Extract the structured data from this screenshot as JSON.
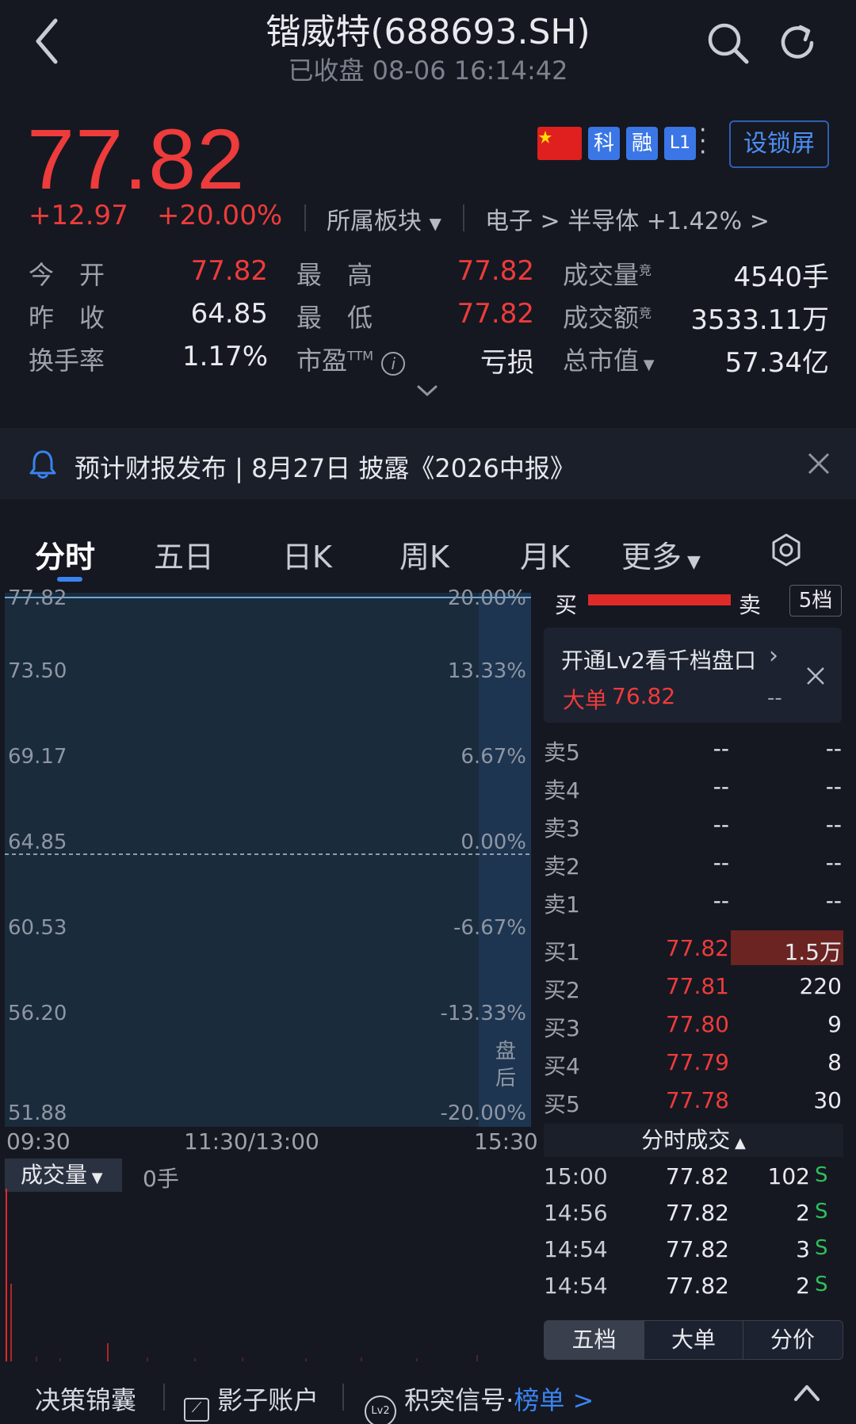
{
  "header": {
    "title": "锴威特(688693.SH)",
    "subtitle": "已收盘 08-06 16:14:42"
  },
  "quote": {
    "price": "77.82",
    "change": "+12.97",
    "change_pct": "+20.00%",
    "sector_label": "所属板块",
    "industry": "电子 > 半导体 +1.42% >",
    "tags": [
      "科",
      "融",
      "L1"
    ],
    "lock_screen": "设锁屏"
  },
  "stats": [
    {
      "label": "今　开",
      "value": "77.82",
      "color": "red"
    },
    {
      "label": "最　高",
      "value": "77.82",
      "color": "red"
    },
    {
      "label": "成交量",
      "sup": "竞",
      "value": "4540手",
      "color": "white"
    },
    {
      "label": "昨　收",
      "value": "64.85",
      "color": "white"
    },
    {
      "label": "最　低",
      "value": "77.82",
      "color": "red"
    },
    {
      "label": "成交额",
      "sup": "竞",
      "value": "3533.11万",
      "color": "white"
    },
    {
      "label": "换手率",
      "value": "1.17%",
      "color": "white"
    },
    {
      "label": "市盈",
      "sup": "TTM",
      "value": "亏损",
      "color": "white"
    },
    {
      "label": "总市值",
      "value": "57.34亿",
      "color": "white"
    }
  ],
  "notice": {
    "text": "预计财报发布 | 8月27日 披露《2026中报》"
  },
  "tabs": [
    "分时",
    "五日",
    "日K",
    "周K",
    "月K",
    "更多"
  ],
  "chart": {
    "price_ticks": [
      "77.82",
      "73.50",
      "69.17",
      "64.85",
      "60.53",
      "56.20",
      "51.88"
    ],
    "pct_ticks": [
      "20.00%",
      "13.33%",
      "6.67%",
      "0.00%",
      "-6.67%",
      "-13.33%",
      "-20.00%"
    ],
    "after_hours_label": "盘后",
    "times": [
      "09:30",
      "11:30/13:00",
      "15:30"
    ],
    "volume_label": "成交量",
    "volume_value": "0手"
  },
  "orderbook": {
    "buy_label": "买",
    "sell_label": "卖",
    "depth_button": "5档",
    "lv2_title": "开通Lv2看千档盘口",
    "lv2_big_label": "大单",
    "lv2_big_value": "76.82",
    "lv2_dash": "--",
    "asks": [
      {
        "label": "卖5",
        "price": "--",
        "qty": "--"
      },
      {
        "label": "卖4",
        "price": "--",
        "qty": "--"
      },
      {
        "label": "卖3",
        "price": "--",
        "qty": "--"
      },
      {
        "label": "卖2",
        "price": "--",
        "qty": "--"
      },
      {
        "label": "卖1",
        "price": "--",
        "qty": "--"
      }
    ],
    "bids": [
      {
        "label": "买1",
        "price": "77.82",
        "qty": "1.5万"
      },
      {
        "label": "买2",
        "price": "77.81",
        "qty": "220"
      },
      {
        "label": "买3",
        "price": "77.80",
        "qty": "9"
      },
      {
        "label": "买4",
        "price": "77.79",
        "qty": "8"
      },
      {
        "label": "买5",
        "price": "77.78",
        "qty": "30"
      }
    ]
  },
  "trades": {
    "header": "分时成交",
    "rows": [
      {
        "time": "15:00",
        "price": "77.82",
        "vol": "102",
        "side": "S"
      },
      {
        "time": "14:56",
        "price": "77.82",
        "vol": "2",
        "side": "S"
      },
      {
        "time": "14:54",
        "price": "77.82",
        "vol": "3",
        "side": "S"
      },
      {
        "time": "14:54",
        "price": "77.82",
        "vol": "2",
        "side": "S"
      }
    ]
  },
  "segments": [
    "五档",
    "大单",
    "分价"
  ],
  "bottom_bar": {
    "item1": "决策锦囊",
    "item2": "影子账户",
    "item3": "积突信号·",
    "item3_link": "榜单 >"
  }
}
